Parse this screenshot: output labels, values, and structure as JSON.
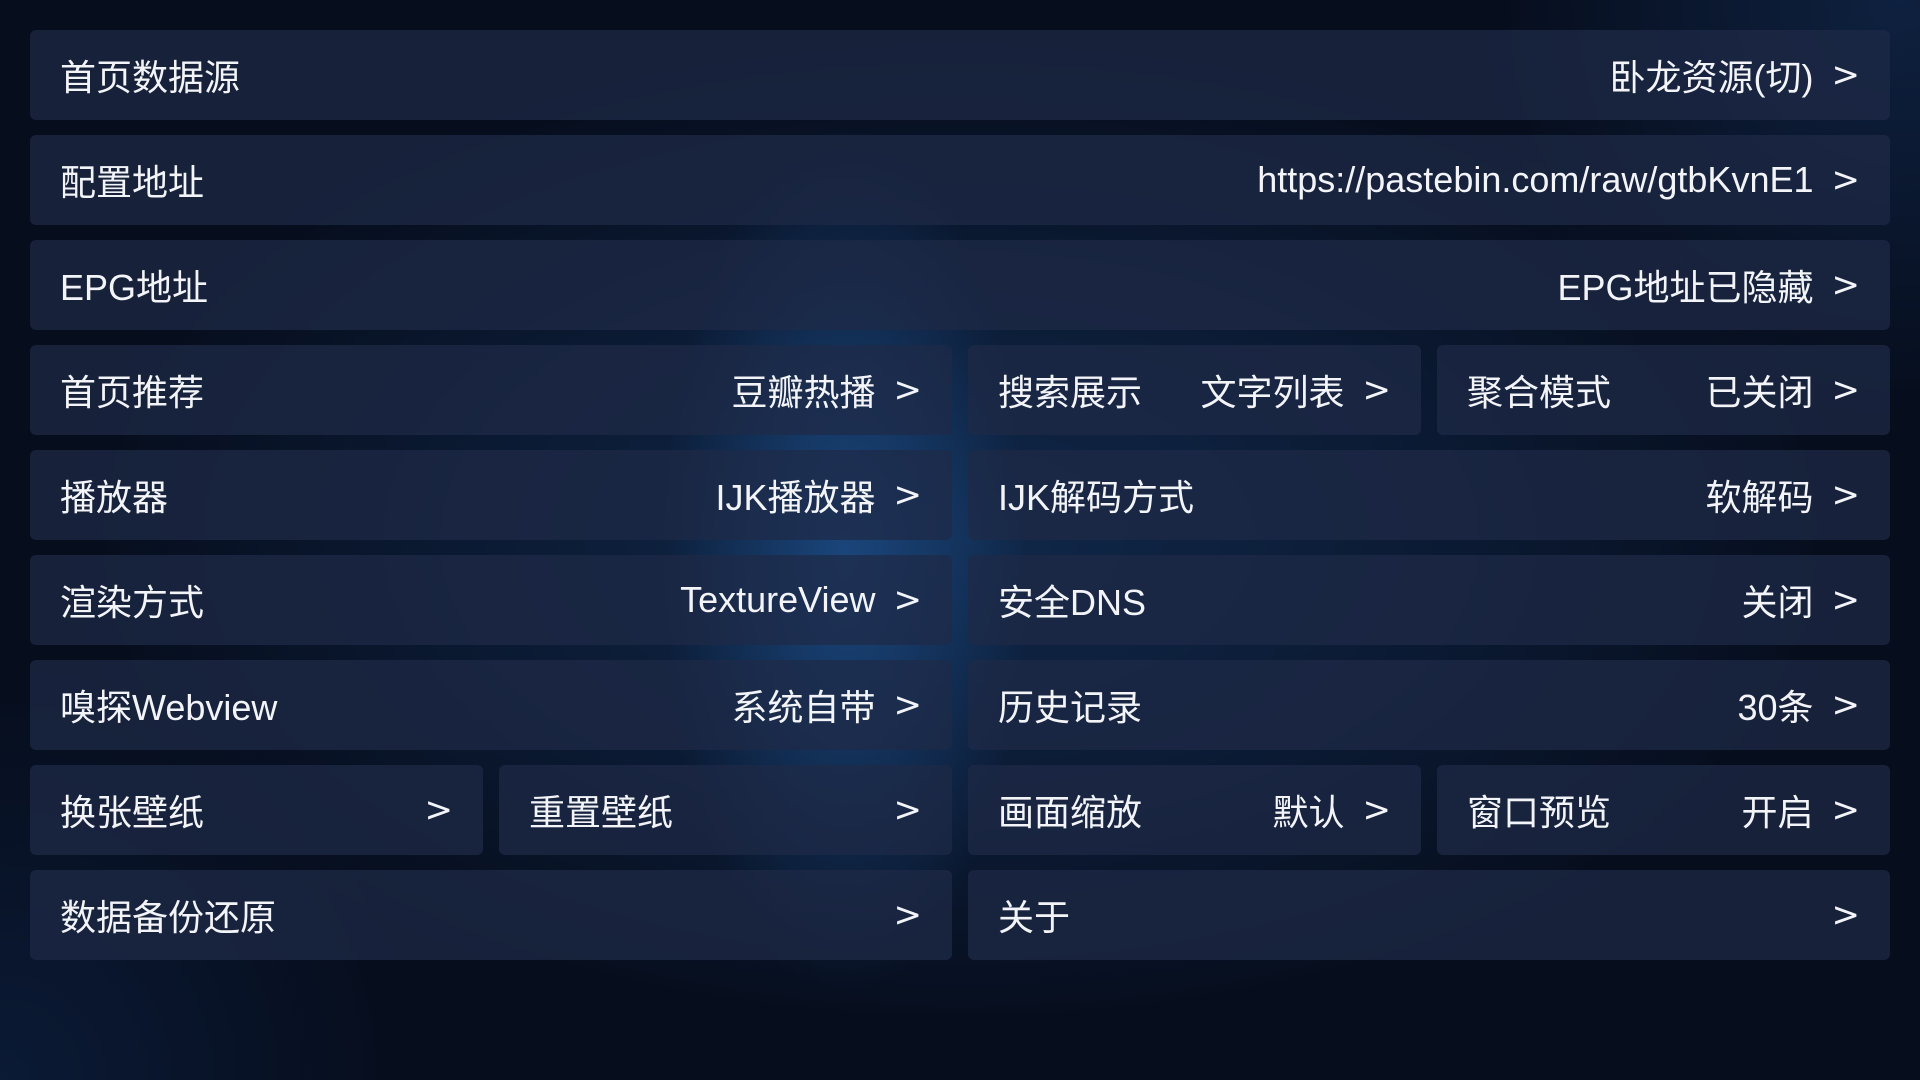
{
  "settings": {
    "home_source": {
      "label": "首页数据源",
      "value": "卧龙资源(切)"
    },
    "config_url": {
      "label": "配置地址",
      "value": "https://pastebin.com/raw/gtbKvnE1"
    },
    "epg_url": {
      "label": "EPG地址",
      "value": "EPG地址已隐藏"
    },
    "home_recommend": {
      "label": "首页推荐",
      "value": "豆瓣热播"
    },
    "search_display": {
      "label": "搜索展示",
      "value": "文字列表"
    },
    "aggregate_mode": {
      "label": "聚合模式",
      "value": "已关闭"
    },
    "player": {
      "label": "播放器",
      "value": "IJK播放器"
    },
    "ijk_decode": {
      "label": "IJK解码方式",
      "value": "软解码"
    },
    "render_mode": {
      "label": "渲染方式",
      "value": "TextureView"
    },
    "secure_dns": {
      "label": "安全DNS",
      "value": "关闭"
    },
    "sniff_webview": {
      "label": "嗅探Webview",
      "value": "系统自带"
    },
    "history": {
      "label": "历史记录",
      "value": "30条"
    },
    "change_wallpaper": {
      "label": "换张壁纸",
      "value": ""
    },
    "reset_wallpaper": {
      "label": "重置壁纸",
      "value": ""
    },
    "screen_scale": {
      "label": "画面缩放",
      "value": "默认"
    },
    "window_preview": {
      "label": "窗口预览",
      "value": "开启"
    },
    "backup_restore": {
      "label": "数据备份还原",
      "value": ""
    },
    "about": {
      "label": "关于",
      "value": ""
    }
  },
  "chevron_glyph": ">",
  "colors": {
    "background": "#0b1a33",
    "item_background": "#1e2a46",
    "text": "#f2f4f8"
  }
}
